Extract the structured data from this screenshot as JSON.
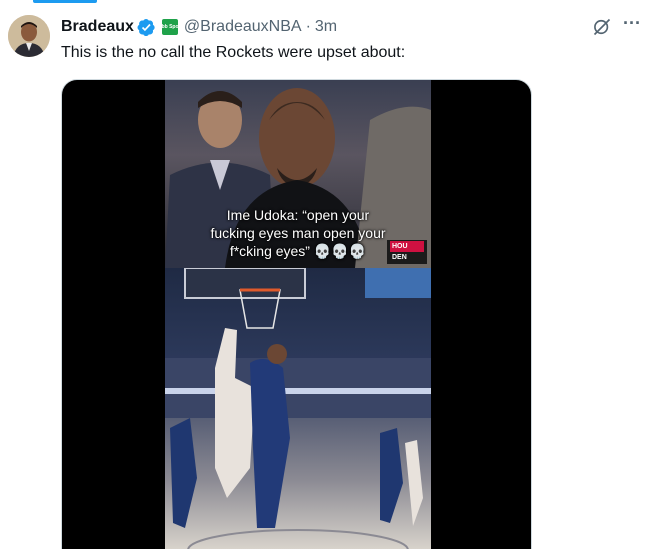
{
  "tweet": {
    "display_name": "Bradeaux",
    "handle": "@BradeauxNBA",
    "separator": "·",
    "time": "3m",
    "text": "This is the no call the Rockets were upset about:",
    "affiliate_badge_text": "Dubb Sports"
  },
  "video": {
    "caption": "Ime Udoka: “open your fucking eyes man open your f*cking eyes” 💀💀💀",
    "scorebug_home": "HOU",
    "scorebug_away": "DEN"
  },
  "icons": {
    "verified": "verified-badge-icon",
    "affiliate": "affiliate-badge-icon",
    "grok": "grok-icon",
    "more": "more-icon"
  },
  "colors": {
    "accent": "#1d9bf0",
    "text_primary": "#0f1419",
    "text_secondary": "#536471",
    "affiliate_green": "#1fa24a"
  }
}
